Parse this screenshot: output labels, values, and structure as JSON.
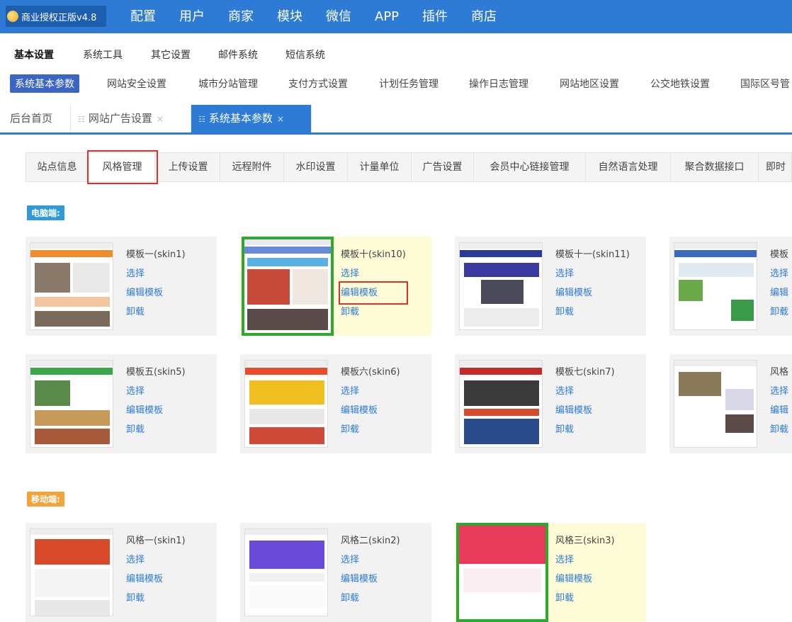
{
  "header": {
    "brand": "商业授权正版v4.8",
    "nav": [
      "配置",
      "用户",
      "商家",
      "模块",
      "微信",
      "APP",
      "插件",
      "商店"
    ]
  },
  "subnav1": [
    "基本设置",
    "系统工具",
    "其它设置",
    "邮件系统",
    "短信系统"
  ],
  "subnav2": [
    "系统基本参数",
    "网站安全设置",
    "城市分站管理",
    "支付方式设置",
    "计划任务管理",
    "操作日志管理",
    "网站地区设置",
    "公交地铁设置",
    "国际区号管"
  ],
  "tabs": [
    {
      "label": "后台首页"
    },
    {
      "label": "网站广告设置",
      "close": "×"
    },
    {
      "label": "系统基本参数",
      "close": "×"
    }
  ],
  "settings_tabs": [
    "站点信息",
    "风格管理",
    "上传设置",
    "远程附件",
    "水印设置",
    "计量单位",
    "广告设置",
    "会员中心链接管理",
    "自然语言处理",
    "聚合数据接口",
    "即时"
  ],
  "sections": {
    "pc": "电脑端:",
    "mobile": "移动端:"
  },
  "actions": {
    "select": "选择",
    "edit": "编辑模板",
    "uninstall": "卸载"
  },
  "pc_templates": [
    {
      "name": "模板一(skin1)",
      "select": "选择",
      "edit": "编辑模板",
      "uninstall": "卸载"
    },
    {
      "name": "模板十(skin10)",
      "select": "选择",
      "edit": "编辑模板",
      "uninstall": "卸载"
    },
    {
      "name": "模板十一(skin11)",
      "select": "选择",
      "edit": "编辑模板",
      "uninstall": "卸载"
    },
    {
      "name": "模板",
      "select": "选择",
      "edit": "编辑",
      "uninstall": "卸载"
    },
    {
      "name": "模板五(skin5)",
      "select": "选择",
      "edit": "编辑模板",
      "uninstall": "卸载"
    },
    {
      "name": "模板六(skin6)",
      "select": "选择",
      "edit": "编辑模板",
      "uninstall": "卸载"
    },
    {
      "name": "模板七(skin7)",
      "select": "选择",
      "edit": "编辑模板",
      "uninstall": "卸载"
    },
    {
      "name": "风格",
      "select": "选择",
      "edit": "编辑",
      "uninstall": "卸载"
    }
  ],
  "mobile_templates": [
    {
      "name": "风格一(skin1)",
      "select": "选择",
      "edit": "编辑模板",
      "uninstall": "卸载"
    },
    {
      "name": "风格二(skin2)",
      "select": "选择",
      "edit": "编辑模板",
      "uninstall": "卸载"
    },
    {
      "name": "风格三(skin3)",
      "select": "选择",
      "edit": "编辑模板",
      "uninstall": "卸载"
    }
  ],
  "colors": {
    "topbar": "#2e7bd6",
    "accent": "#3a65c5",
    "active_border": "#2fa82f",
    "highlight": "#d8322b"
  }
}
